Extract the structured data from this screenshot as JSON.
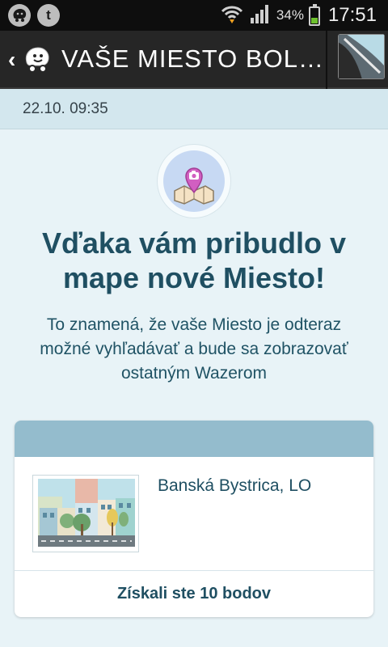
{
  "status_bar": {
    "left_icons": [
      "waze-notification-icon",
      "tumblr-notification-icon"
    ],
    "tumblr_glyph": "t",
    "battery_percent": "34%",
    "battery_level": 0.34,
    "time": "17:51"
  },
  "app_bar": {
    "back_icon": "chevron-left-icon",
    "app_icon": "waze-icon",
    "title": "VAŠE MIESTO BOLO…"
  },
  "date_bar": {
    "datetime": "22.10. 09:35"
  },
  "main": {
    "icon": "map-place-camera-icon",
    "headline": "Vďaka vám pribudlo v mape nové Miesto!",
    "subtitle": "To znamená, že vaše Miesto je odteraz možné vyhľadávať a bude sa zobrazovať ostatným Wazerom"
  },
  "card": {
    "place_name": "Banská Bystrica, LO",
    "points_text": "Získali ste 10 bodov"
  },
  "colors": {
    "accent": "#1f4f62",
    "card_header": "#94bccd",
    "date_bar": "#d3e7ee",
    "background": "#e8f3f7"
  }
}
